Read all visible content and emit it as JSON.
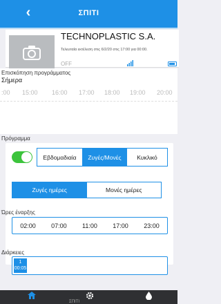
{
  "header": {
    "title": "ΣΠΙΤΙ"
  },
  "device": {
    "name": "TECHNOPLASTIC S.A.",
    "last_run": "Τελευταία εκτέλεση στις 6/2/20 στις 17:00 για 00:00.",
    "state": "OFF"
  },
  "overview": {
    "title": "Επισκόπηση προγράμματος",
    "day": "Σήμερα",
    "ticks": [
      ":00",
      "15:00",
      "16:00",
      "17:00",
      "18:00",
      "19:00",
      "20:00"
    ]
  },
  "program": {
    "label": "Πρόγραμμα",
    "enabled": true,
    "modes": [
      "Εβδομαδιαία",
      "Ζυγές/Μονές",
      "Κυκλικό"
    ],
    "active_mode": "Ζυγές/Μονές",
    "day_types": [
      "Ζυγές ημέρες",
      "Μονές ημέρες"
    ],
    "active_day_type": "Ζυγές ημέρες"
  },
  "start_times": {
    "label": "Ώρες έναρξης",
    "times": [
      "02:00",
      "07:00",
      "11:00",
      "17:00",
      "23:00"
    ]
  },
  "durations": {
    "label": "Διάρκειες",
    "items": [
      {
        "index": "1",
        "value": "00:05"
      }
    ]
  },
  "tabbar": {
    "caption": "ΣΠΙΤΙ",
    "tabs": [
      "home-icon",
      "gear-icon",
      "water-drop-icon"
    ]
  },
  "colors": {
    "accent": "#1e90e6",
    "toggle_on": "#3cc43c",
    "tabbar": "#2f3033"
  }
}
